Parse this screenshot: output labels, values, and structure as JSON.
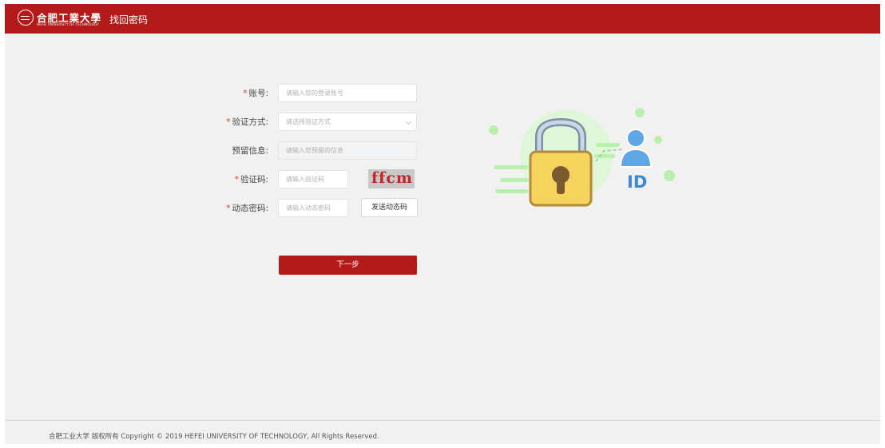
{
  "header": {
    "logo_name": "合肥工業大學",
    "logo_subtitle": "HEFEI UNIVERSITY OF TECHNOLOGY",
    "title": "找回密码"
  },
  "form": {
    "required_mark": "*",
    "account": {
      "label": "账号:",
      "placeholder": "请输入您的登录账号"
    },
    "method": {
      "label": "验证方式:",
      "placeholder": "请选择验证方式"
    },
    "reserved": {
      "label": "预留信息:",
      "placeholder": "请输入您预留的信息"
    },
    "captcha": {
      "label": "验证码:",
      "placeholder": "请输入验证码",
      "image_text": "ffcm"
    },
    "dynamic": {
      "label": "动态密码:",
      "placeholder": "请输入动态密码",
      "send_button": "发送动态码"
    },
    "next_button": "下一步"
  },
  "illustration": {
    "id_text": "ID",
    "icons": [
      "padlock-icon",
      "user-icon"
    ]
  },
  "footer": {
    "copyright": "合肥工业大学 版权所有 Copyright © 2019 HEFEI UNIVERSITY OF TECHNOLOGY, All Rights Reserved."
  },
  "colors": {
    "brand": "#b31b1b",
    "required": "#d23a3a",
    "lock_body": "#f6d35c",
    "lock_border": "#b3893c",
    "user": "#5fa6e6",
    "accent_green": "#a8ee9c"
  }
}
